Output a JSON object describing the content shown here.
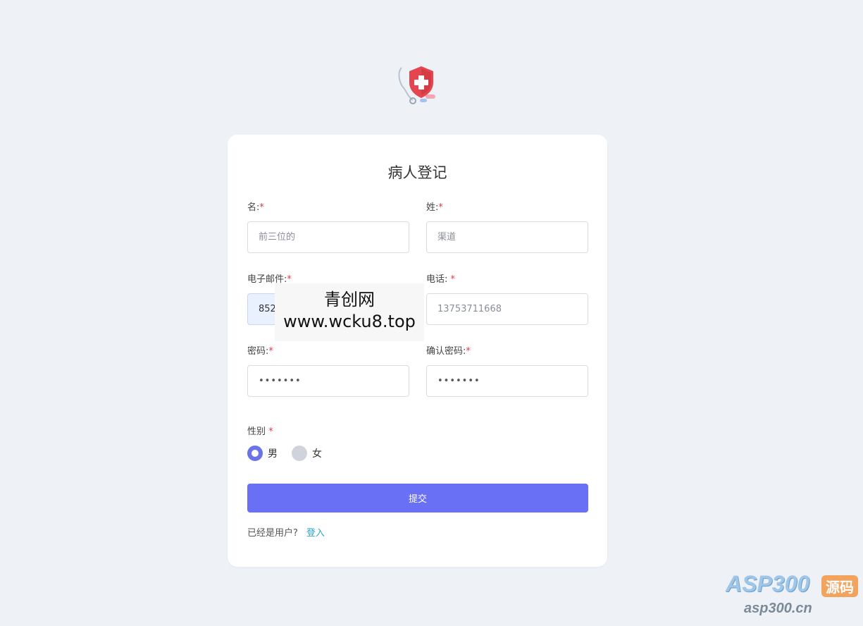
{
  "form": {
    "title": "病人登记",
    "first_name": {
      "label": "名:",
      "required": "*",
      "placeholder": "前三位的"
    },
    "last_name": {
      "label": "姓:",
      "required": "*",
      "placeholder": "渠道"
    },
    "email": {
      "label": "电子邮件:",
      "required": "*",
      "value": "852"
    },
    "phone": {
      "label": "电话: ",
      "required": "*",
      "placeholder": "13753711668"
    },
    "password": {
      "label": "密码:",
      "required": "*",
      "value": "•••••••"
    },
    "confirm_password": {
      "label": "确认密码:",
      "required": "*",
      "value": "•••••••"
    },
    "gender": {
      "label": "性别 ",
      "required": "*",
      "options": [
        "男",
        "女"
      ],
      "selected": "男"
    },
    "submit_label": "提交",
    "footer": {
      "text": "已经是用户?",
      "link_label": "登入"
    }
  },
  "watermark": {
    "line1": "青创网",
    "line2": "www.wcku8.top"
  },
  "corner_watermark": {
    "brand": "ASP300",
    "badge": "源码",
    "domain": "asp300.cn"
  },
  "colors": {
    "accent": "#6a70f5",
    "link": "#2aa6c9",
    "required": "#e2394a",
    "background": "#eef2f7"
  }
}
